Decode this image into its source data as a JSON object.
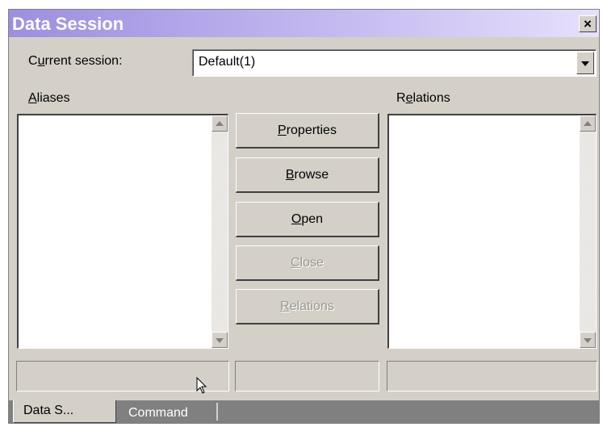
{
  "window": {
    "title": "Data Session",
    "close_glyph": "×"
  },
  "session": {
    "label_pre": "C",
    "label_ul": "u",
    "label_post": "rrent session:",
    "value": "Default(1)"
  },
  "aliases": {
    "label_ul": "A",
    "label_post": "liases"
  },
  "relations_panel": {
    "label_pre": "R",
    "label_ul": "e",
    "label_post": "lations"
  },
  "buttons": {
    "properties": {
      "ul": "P",
      "rest": "roperties",
      "enabled": true
    },
    "browse": {
      "ul": "B",
      "rest": "rowse",
      "enabled": true
    },
    "open": {
      "ul": "O",
      "rest": "pen",
      "enabled": true
    },
    "close": {
      "ul": "C",
      "rest": "lose",
      "enabled": false
    },
    "relations": {
      "ul": "R",
      "rest": "elations",
      "enabled": false
    }
  },
  "tabs": {
    "active": "Data S...",
    "inactive": "Command"
  },
  "icons": [
    "close-icon",
    "dropdown-arrow-icon",
    "scroll-up-icon",
    "scroll-down-icon",
    "mouse-cursor-icon"
  ],
  "colors": {
    "title_gradient_start": "#9e8ee0",
    "title_gradient_end": "#e6e0fb",
    "face": "#d4d0c8",
    "tabstrip": "#808080"
  }
}
